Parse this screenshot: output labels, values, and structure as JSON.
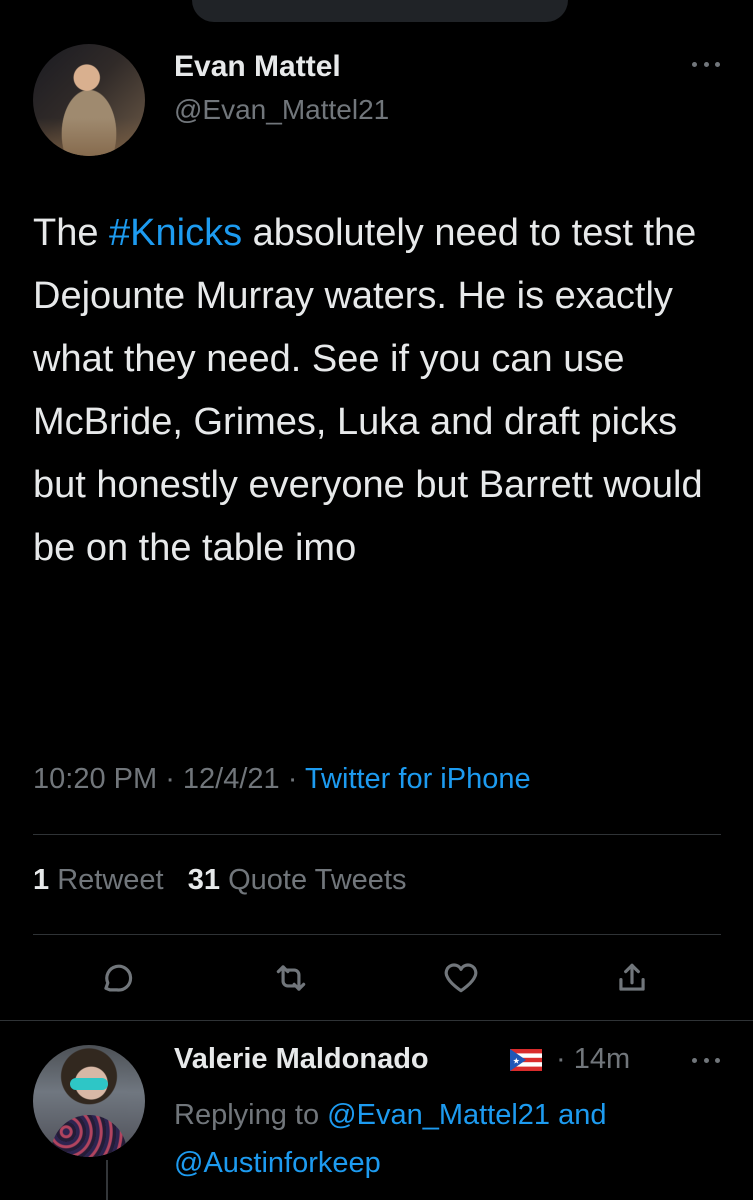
{
  "colors": {
    "background": "#000000",
    "text_primary": "#e7e9ea",
    "text_secondary": "#71767b",
    "accent": "#1d9bf0",
    "divider": "#2f3336"
  },
  "tweet": {
    "author": {
      "name": "Evan Mattel",
      "handle": "@Evan_Mattel21",
      "avatar_icon": "avatar-photo"
    },
    "body": {
      "prefix": "The ",
      "hashtag": "#Knicks",
      "rest": " absolutely need to test the Dejounte Murray waters. He is exactly what they need. See if you can use McBride, Grimes, Luka and draft picks but honestly everyone but Barrett would be on the table imo"
    },
    "meta": {
      "time": "10:20 PM",
      "separator1": " · ",
      "date": "12/4/21",
      "separator2": " · ",
      "source": "Twitter for iPhone"
    },
    "stats": {
      "retweets_count": "1",
      "retweets_label": "Retweet",
      "quotes_count": "31",
      "quotes_label": "Quote Tweets"
    },
    "actions": [
      {
        "icon": "reply-icon"
      },
      {
        "icon": "retweet-icon"
      },
      {
        "icon": "like-icon"
      },
      {
        "icon": "share-icon"
      }
    ]
  },
  "reply": {
    "author": {
      "name": "Valerie Maldonado",
      "flag_icon": "puerto-rico-flag-icon",
      "time": "· 14m"
    },
    "replying_prefix": "Replying to ",
    "mention1": "@Evan_Mattel21",
    "conjunction": " and",
    "mention2": "@Austinforkeep"
  }
}
